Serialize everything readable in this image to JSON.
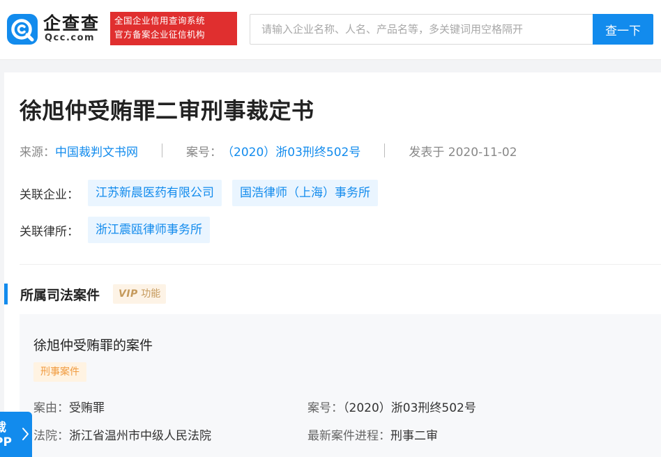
{
  "header": {
    "logo_name": "企查查",
    "logo_domain": "Qcc.com",
    "badge_line1": "全国企业信用查询系统",
    "badge_line2": "官方备案企业征信机构",
    "search_placeholder": "请输入企业名称、人名、产品名等，多关键词用空格隔开",
    "search_value": "",
    "search_button": "查一下"
  },
  "document": {
    "title": "徐旭仲受贿罪二审刑事裁定书",
    "source_label": "来源：",
    "source_value": "中国裁判文书网",
    "case_no_label": "案号：",
    "case_no_value": "（2020）浙03刑终502号",
    "published": "发表于 2020-11-02"
  },
  "related": {
    "company_label": "关联企业：",
    "companies": [
      "江苏新晨医药有限公司",
      "国浩律师（上海）事务所"
    ],
    "lawfirm_label": "关联律所：",
    "lawfirms": [
      "浙江震瓯律师事务所"
    ]
  },
  "section": {
    "title": "所属司法案件",
    "vip_mark": "VIP",
    "vip_text": "功能"
  },
  "case": {
    "title": "徐旭仲受贿罪的案件",
    "type_tag": "刑事案件",
    "cause_label": "案由：",
    "cause_value": "受贿罪",
    "case_no_label": "案号：",
    "case_no_value": "（2020）浙03刑终502号",
    "court_label": "法院：",
    "court_value": "浙江省温州市中级人民法院",
    "progress_label": "最新案件进程：",
    "progress_value": "刑事二审"
  },
  "float_app": {
    "line1": "载",
    "line2": "PP"
  },
  "colors": {
    "accent": "#128bed",
    "badge_red": "#e02f2f",
    "tag_bg": "#eaf5ff",
    "vip_gold": "#c59a5c",
    "case_type_orange": "#f09a3d"
  }
}
